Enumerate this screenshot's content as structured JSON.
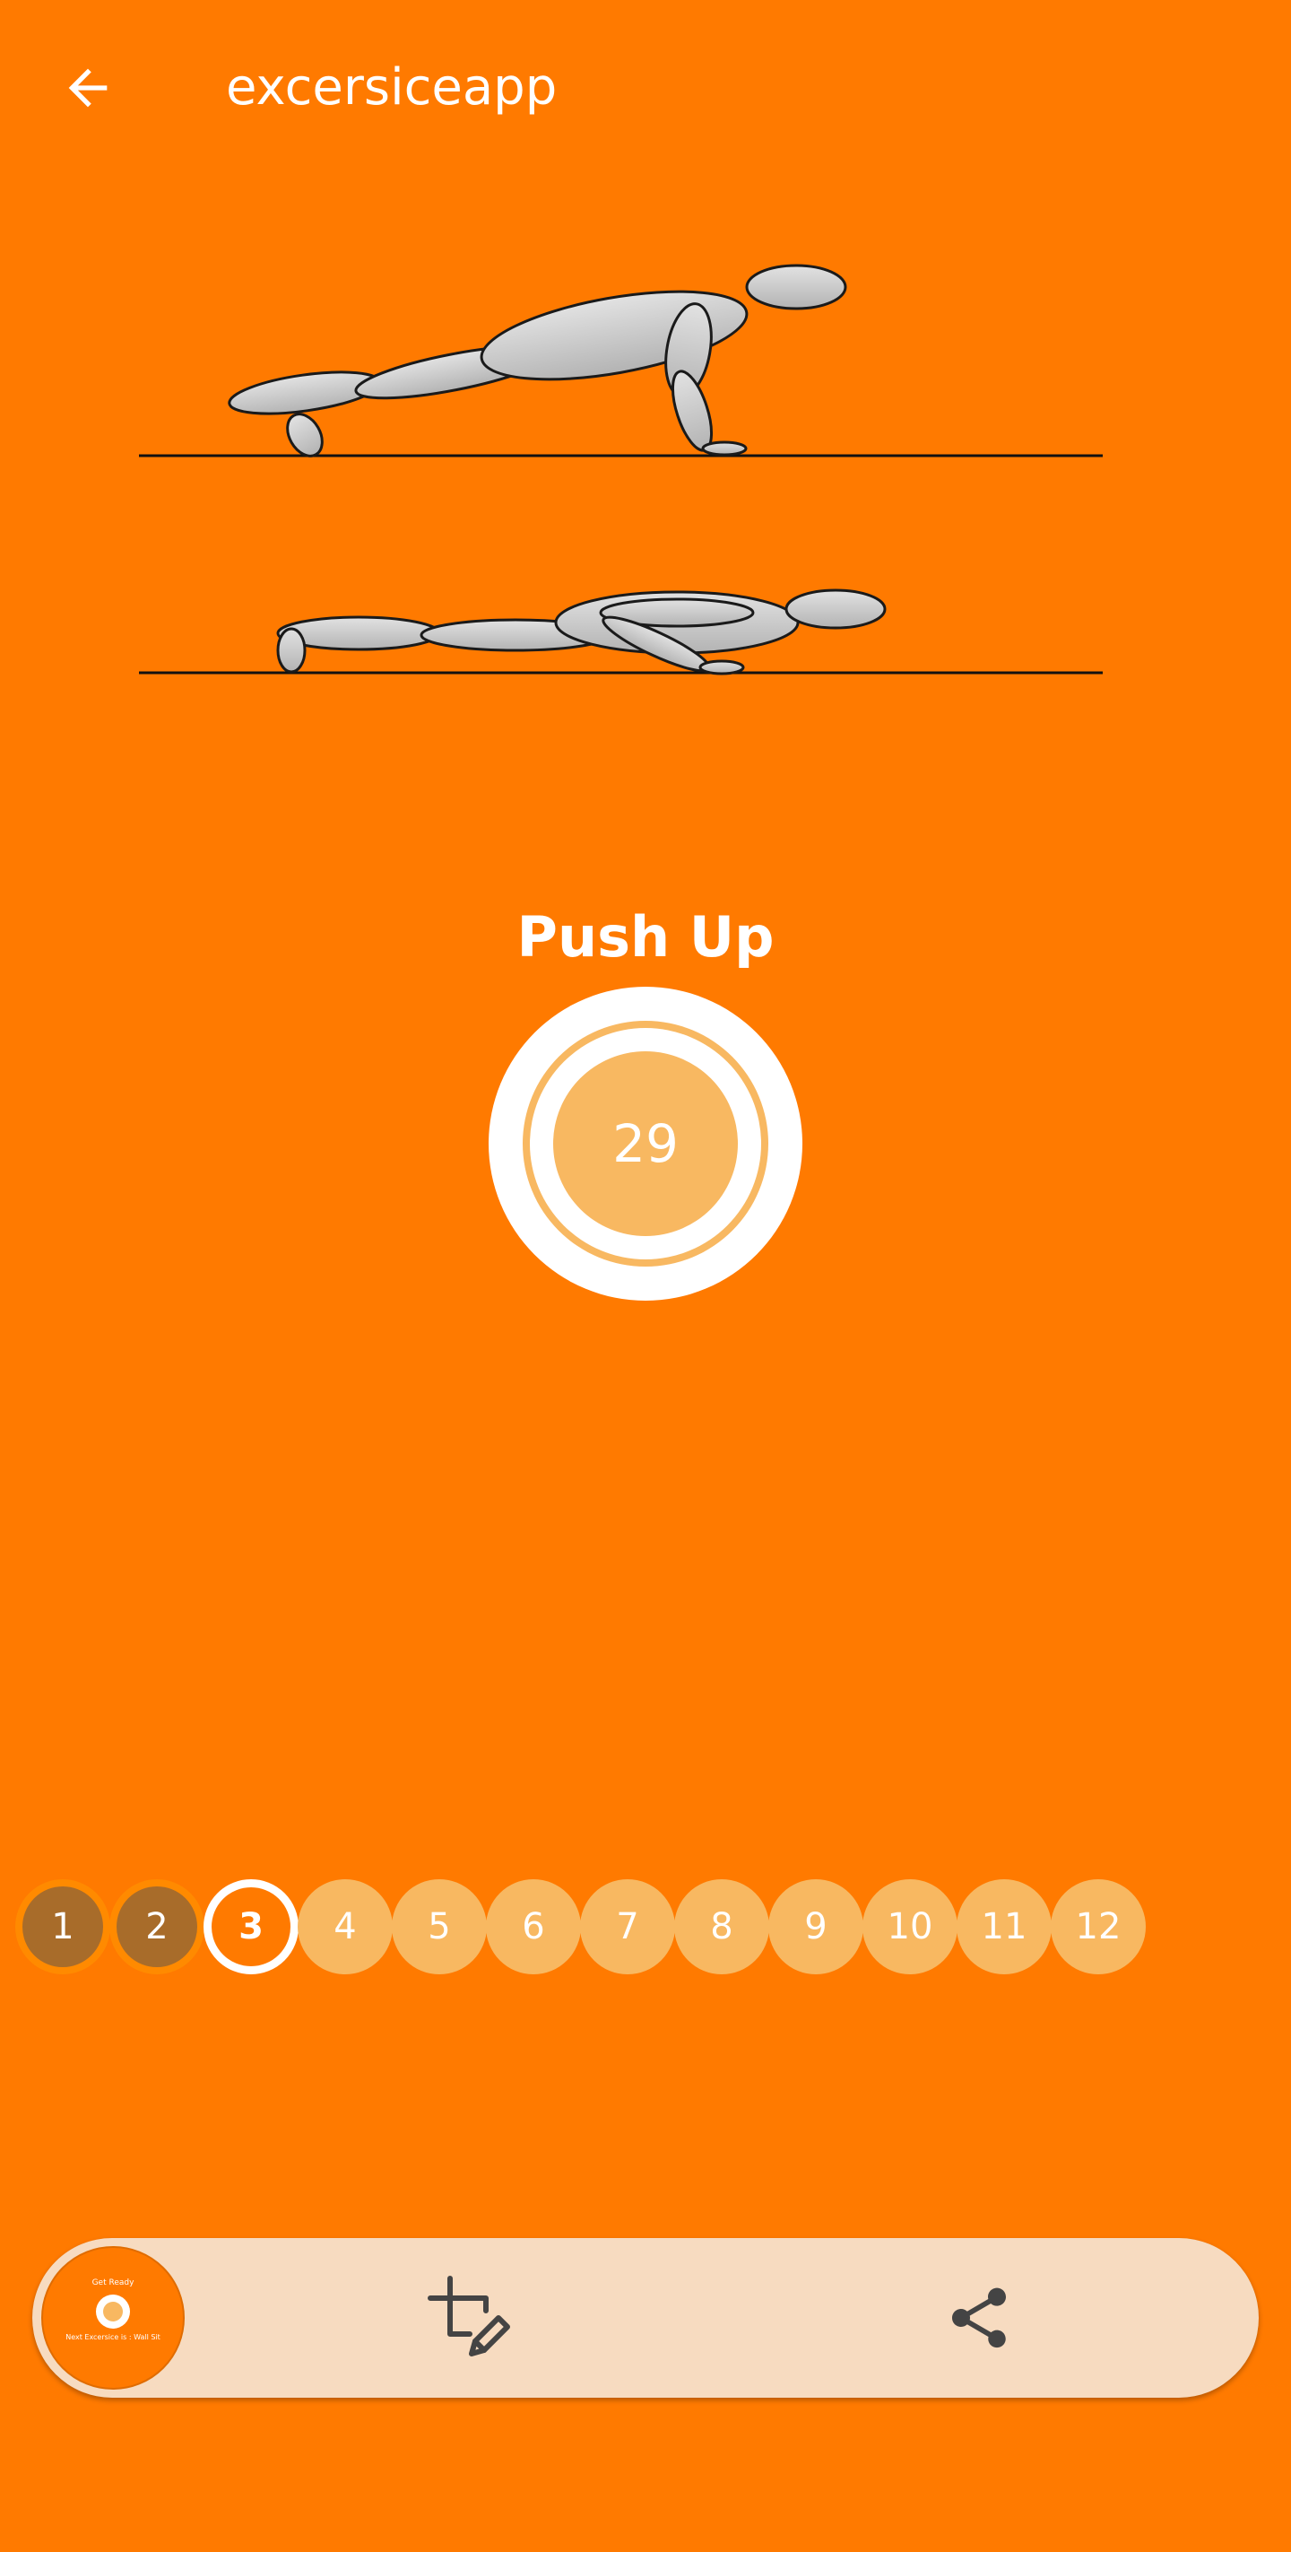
{
  "app_bar": {
    "title": "excersiceapp",
    "back_icon": "arrow-back-icon"
  },
  "illustration": {
    "frames": [
      "push-up-high-position",
      "push-up-low-position"
    ]
  },
  "exercise": {
    "name": "Push Up",
    "countdown": "29"
  },
  "progress": {
    "steps": [
      {
        "label": "1",
        "state": "done"
      },
      {
        "label": "2",
        "state": "done"
      },
      {
        "label": "3",
        "state": "current"
      },
      {
        "label": "4",
        "state": "todo"
      },
      {
        "label": "5",
        "state": "todo"
      },
      {
        "label": "6",
        "state": "todo"
      },
      {
        "label": "7",
        "state": "todo"
      },
      {
        "label": "8",
        "state": "todo"
      },
      {
        "label": "9",
        "state": "todo"
      },
      {
        "label": "10",
        "state": "todo"
      },
      {
        "label": "11",
        "state": "todo"
      },
      {
        "label": "12",
        "state": "todo"
      }
    ]
  },
  "bottom_bar": {
    "fab_get_ready": "Get Ready",
    "fab_next": "Next Excersice is : Wall Sit",
    "edit_icon": "crop-edit-icon",
    "share_icon": "share-icon"
  },
  "colors": {
    "background": "#FF7A00",
    "accent_light": "#F8B861",
    "done_step": "#A86C2A",
    "bottom_bar": "#F7DBC0",
    "icon_dark": "#444444"
  }
}
